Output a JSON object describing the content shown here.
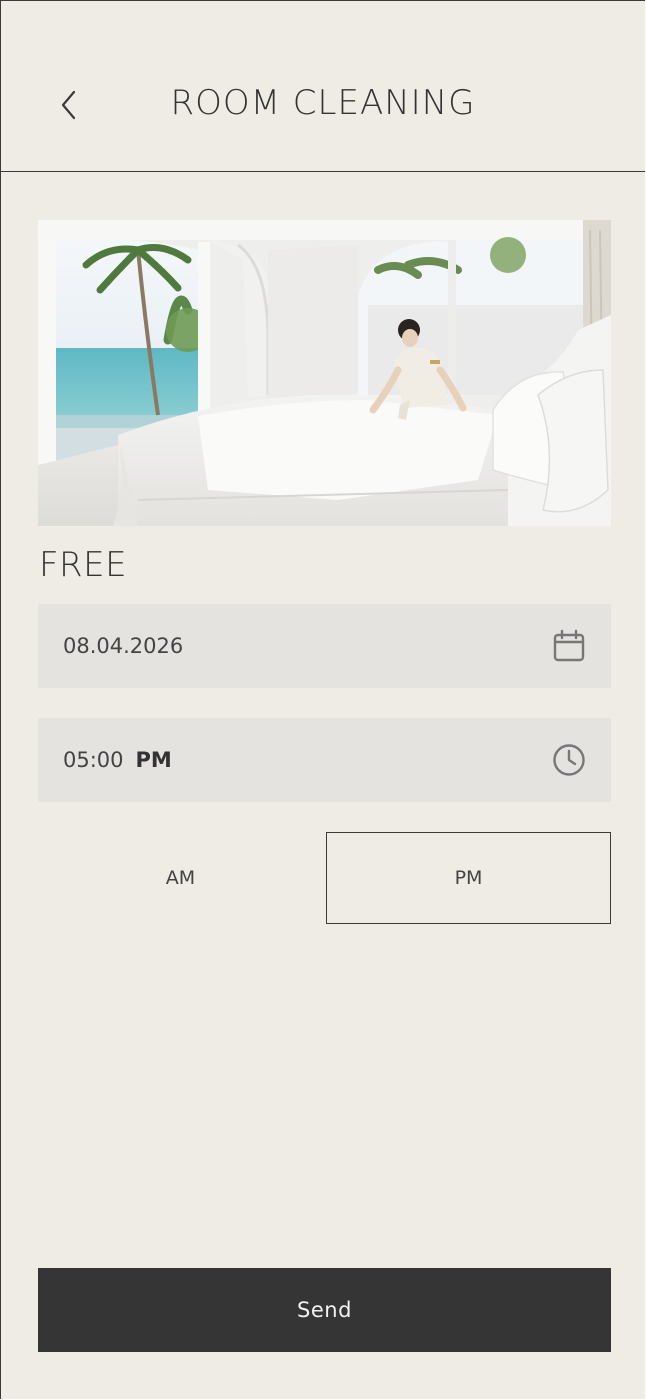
{
  "header": {
    "title": "ROOM CLEANING",
    "back_icon": "chevron-left-icon"
  },
  "hero": {
    "alt": "Housekeeper making a bed in a bright white villa bedroom with ocean view"
  },
  "service": {
    "price_label": "FREE"
  },
  "date_field": {
    "value": "08.04.2026",
    "icon": "calendar-icon"
  },
  "time_field": {
    "value": "05:00",
    "period": "PM",
    "icon": "clock-icon"
  },
  "period_toggle": {
    "am_label": "AM",
    "pm_label": "PM",
    "selected": "PM"
  },
  "actions": {
    "send_label": "Send"
  },
  "colors": {
    "background": "#efebe5",
    "field_background": "#e5e3df",
    "text": "#333333",
    "button_background": "#353535",
    "button_text": "#f2f2f2"
  }
}
